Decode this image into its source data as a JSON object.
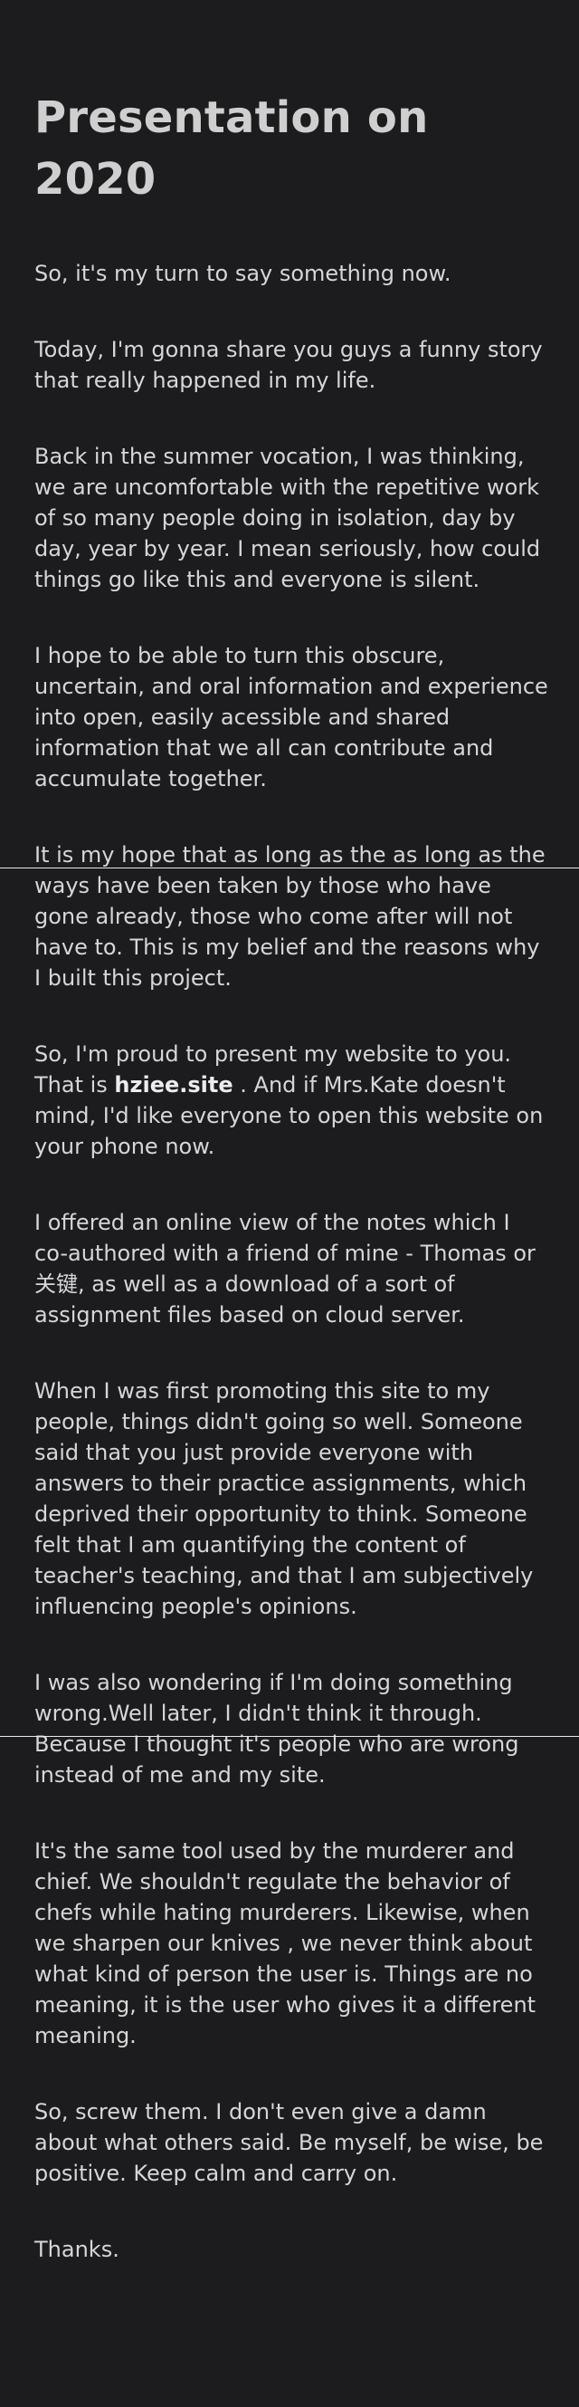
{
  "page": {
    "title": "Presentation on 2020",
    "paragraphs": [
      "So, it's my turn to say something now.",
      "Today, I'm gonna share you guys a funny story that really happened in my life.",
      "Back in the summer vocation, I was thinking, we are uncomfortable with the repetitive work of so many people doing in isolation, day by day, year by year. I mean seriously, how could things go like this and everyone is silent.",
      "I hope to be able to turn this obscure, uncertain, and oral information and experience into open, easily acessible and shared information that we all can contribute and accumulate together.",
      "It is my hope that as long as the as long as the ways have been taken by those who have gone already, those who come after will not have to. This is my belief and the reasons why I built this project."
    ],
    "website_paragraph": {
      "before": "So, I'm proud to present my website to you. That is ",
      "site_name": "hziee.site",
      "after": " . And if Mrs.Kate doesn't mind, I'd like everyone to open this website on your phone now."
    },
    "paragraphs_after": [
      "I offered an online view of the notes which I co-authored with a friend of mine - Thomas or 关键, as well as a download of a sort of assignment files based on cloud server.",
      "When I was first promoting this site to my people, things didn't going so well. Someone said that you just provide everyone with answers to their practice assignments, which deprived their opportunity to think. Someone felt that I am quantifying the content of teacher's teaching, and that I am subjectively influencing people's opinions.",
      "I was also wondering if I'm doing something wrong.Well later, I didn't think it through. Because I thought it's people who are wrong instead of me and my site.",
      "It's the same tool used by the murderer and chief. We shouldn't regulate the behavior of chefs while hating murderers. Likewise, when we sharpen our knives , we never think about what kind of person the user is. Things are no meaning, it is the user who gives it a different meaning.",
      "So, screw them. I don't even give a damn about what others said. Be myself, be wise, be positive. Keep calm and carry on.",
      "Thanks."
    ]
  }
}
